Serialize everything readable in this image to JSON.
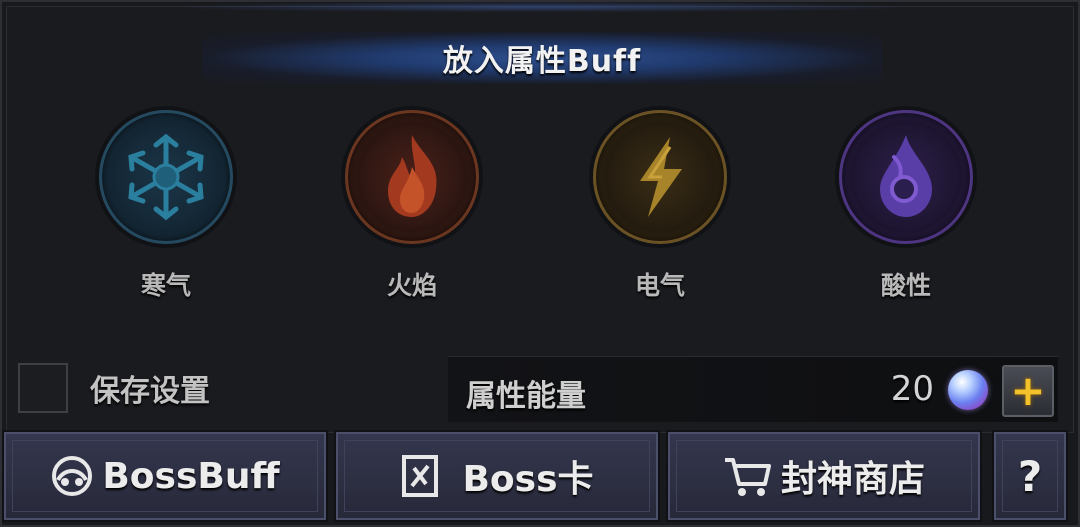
{
  "title": "放入属性Buff",
  "buffs": [
    {
      "label": "寒气",
      "icon": "snowflake-icon",
      "color": "#2a7a9a"
    },
    {
      "label": "火焰",
      "icon": "flame-icon",
      "color": "#b04a2a"
    },
    {
      "label": "电气",
      "icon": "lightning-icon",
      "color": "#b08a2a"
    },
    {
      "label": "酸性",
      "icon": "acid-drop-icon",
      "color": "#6a4ab8"
    }
  ],
  "save_settings": {
    "label": "保存设置",
    "checked": false
  },
  "energy": {
    "label": "属性能量",
    "value": "20",
    "add_symbol": "+"
  },
  "buttons": {
    "boss_buff": "BossBuff",
    "boss_card": "Boss卡",
    "shop": "封神商店",
    "help": "?"
  }
}
